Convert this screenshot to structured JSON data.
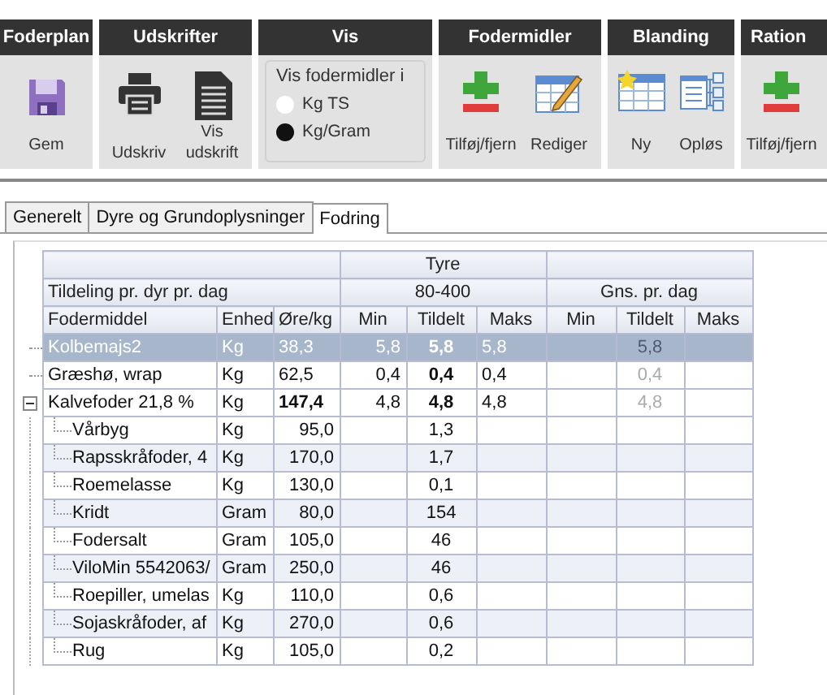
{
  "ribbon": {
    "groups": [
      {
        "title": "Foderplan",
        "kind": "buttons",
        "buttons": [
          {
            "label": "Gem"
          }
        ]
      },
      {
        "title": "Udskrifter",
        "kind": "buttons",
        "buttons": [
          {
            "label": "Udskriv"
          },
          {
            "label": "Vis udskrift"
          }
        ]
      },
      {
        "title": "Vis",
        "kind": "radio",
        "caption": "Vis fodermidler i",
        "options": [
          {
            "label": "Kg TS",
            "selected": false
          },
          {
            "label": "Kg/Gram",
            "selected": true
          }
        ]
      },
      {
        "title": "Fodermidler",
        "kind": "buttons",
        "buttons": [
          {
            "label": "Tilføj/fjern"
          },
          {
            "label": "Rediger"
          }
        ]
      },
      {
        "title": "Blanding",
        "kind": "buttons",
        "buttons": [
          {
            "label": "Ny"
          },
          {
            "label": "Opløs"
          }
        ]
      },
      {
        "title": "Ration",
        "kind": "buttons",
        "buttons": [
          {
            "label": "Tilføj/fjern"
          }
        ]
      }
    ]
  },
  "tabs": [
    {
      "label": "Generelt",
      "selected": false
    },
    {
      "label": "Dyre og Grundoplysninger",
      "selected": false
    },
    {
      "label": "Fodring",
      "selected": true
    }
  ],
  "table": {
    "group_header": "Tyre",
    "allocation_label": "Tildeling pr. dyr pr. dag",
    "range": "80-400",
    "average_label": "Gns. pr. dag",
    "columns": [
      "Fodermiddel",
      "Enhed",
      "Øre/kg",
      "Min",
      "Tildelt",
      "Maks",
      "Min",
      "Tildelt",
      "Maks"
    ],
    "rows": [
      {
        "kind": "feed",
        "name": "Kolbemajs2",
        "unit": "Kg",
        "price": "38,3",
        "min": "5,8",
        "alloc": "5,8",
        "max": "5,8",
        "avg_alloc": "5,8",
        "selected": true
      },
      {
        "kind": "feed",
        "name": "Græshø, wrap",
        "unit": "Kg",
        "price": "62,5",
        "min": "0,4",
        "alloc": "0,4",
        "max": "0,4",
        "avg_alloc": "0,4",
        "selected": false
      },
      {
        "kind": "mix",
        "name": "Kalvefoder 21,8 %",
        "unit": "Kg",
        "price": "147,4",
        "min": "4,8",
        "alloc": "4,8",
        "max": "4,8",
        "avg_alloc": "4,8",
        "selected": false,
        "expanded": true,
        "children": [
          {
            "name": "Vårbyg",
            "unit": "Kg",
            "price": "95,0",
            "alloc": "1,3"
          },
          {
            "name": "Rapsskråfoder, 4",
            "unit": "Kg",
            "price": "170,0",
            "alloc": "1,7"
          },
          {
            "name": "Roemelasse",
            "unit": "Kg",
            "price": "130,0",
            "alloc": "0,1"
          },
          {
            "name": "Kridt",
            "unit": "Gram",
            "price": "80,0",
            "alloc": "154"
          },
          {
            "name": "Fodersalt",
            "unit": "Gram",
            "price": "105,0",
            "alloc": "46"
          },
          {
            "name": "ViloMin 5542063/",
            "unit": "Gram",
            "price": "250,0",
            "alloc": "46"
          },
          {
            "name": "Roepiller, umelas",
            "unit": "Kg",
            "price": "110,0",
            "alloc": "0,6"
          },
          {
            "name": "Sojaskråfoder, af",
            "unit": "Kg",
            "price": "270,0",
            "alloc": "0,6"
          },
          {
            "name": "Rug",
            "unit": "Kg",
            "price": "105,0",
            "alloc": "0,2"
          }
        ]
      }
    ]
  }
}
